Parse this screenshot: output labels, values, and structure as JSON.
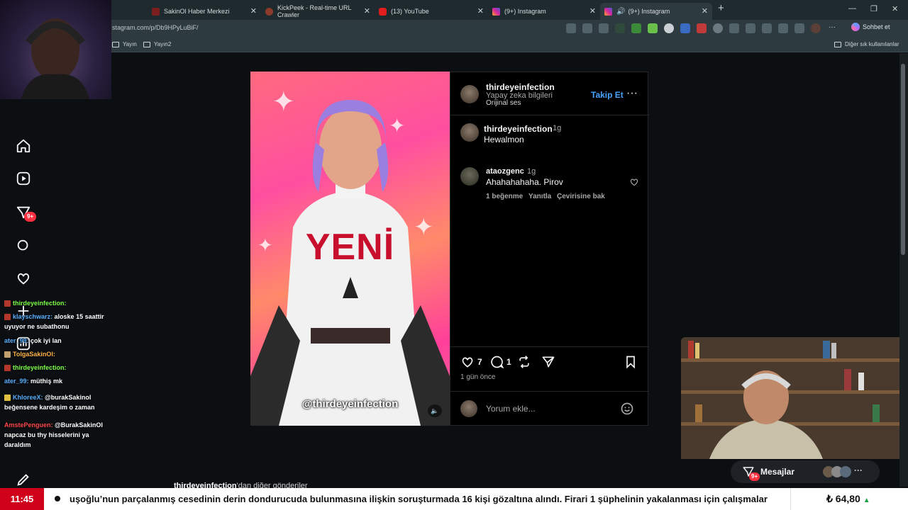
{
  "browser": {
    "tabs": [
      {
        "label": "SakinOl Haber Merkezi",
        "color": "#7a1e1e"
      },
      {
        "label": "KickPeek - Real-time URL Crawler",
        "color": "#8c3a2a"
      },
      {
        "label": "(13) YouTube",
        "color": "#e01e1e"
      },
      {
        "label": "(9+) Instagram",
        "color": "#d6249f"
      },
      {
        "label": "(9+) Instagram",
        "color": "#d6249f"
      }
    ],
    "url": "stagram.com/p/Db9HPyLuBiF/",
    "bookmarks": [
      "Yayın",
      "Yayın2"
    ],
    "other_bookmarks": "Diğer sık kullanılanlar",
    "chat_button": "Sohbet et"
  },
  "instagram": {
    "nav_badge": "9+",
    "post": {
      "username": "thirdeyeinfection",
      "subtitle": "Yapay zeka bilgileri",
      "audio": "Orijinal ses",
      "follow": "Takip Et",
      "caption_user": "thirdeyeinfection",
      "caption_age": "1g",
      "caption_text": "Hewalmon",
      "shirt_text": "YENİ",
      "handle_overlay": "@thirdeyeinfection",
      "comment": {
        "user": "ataozgenc",
        "age": "1g",
        "text": "Ahahahahaha. Pirov",
        "likes": "1 beğenme",
        "reply": "Yanıtla",
        "translate": "Çevirisine bak"
      },
      "like_count": "7",
      "comment_count": "1",
      "time_ago": "1 gün önce",
      "comment_placeholder": "Yorum ekle..."
    },
    "more_posts_user": "thirdeyeinfection",
    "more_posts_suffix": "'dan diğer gönderiler",
    "messages_button": "Mesajlar",
    "messages_badge": "9+"
  },
  "stream_chat": [
    {
      "user": "thirdeyeinfection:",
      "msg": "",
      "color": "#7cff4a"
    },
    {
      "user": "klayschwarz:",
      "msg": "aloske 15 saattir",
      "color": "#5ab0ff"
    },
    {
      "user": "",
      "msg": "uyuyor ne subathonu",
      "color": "#ffffff"
    },
    {
      "user": "ater_99:",
      "msg": "çok iyi lan",
      "color": "#5ab0ff"
    },
    {
      "user": "TolgaSakinOl:",
      "msg": "",
      "color": "#ffb24a"
    },
    {
      "user": "thirdeyeinfection:",
      "msg": "",
      "color": "#7cff4a"
    },
    {
      "user": "ater_99:",
      "msg": "müthiş mk",
      "color": "#5ab0ff"
    },
    {
      "user": "KhloreeX:",
      "msg": "@burakSakinol",
      "color": "#5ab0ff"
    },
    {
      "user": "",
      "msg": "beğensene kardeşim o zaman",
      "color": "#ffffff"
    },
    {
      "user": "AmstePenguen:",
      "msg": "@BurakSakinOl",
      "color": "#ff4a4a"
    },
    {
      "user": "",
      "msg": "napcaz bu thy hisselerini ya",
      "color": "#ffffff"
    },
    {
      "user": "",
      "msg": "daraldım",
      "color": "#ffffff"
    }
  ],
  "ticker": {
    "time": "11:45",
    "headline": "uşoğlu’nun parçalanmış cesedinin derin dondurucuda bulunmasına ilişkin soruşturmada 16 kişi gözaltına alındı. Firari 1 şüphelinin yakalanması için çalışmalar",
    "price": "₺ 64,80",
    "price_arrow": "▲"
  }
}
